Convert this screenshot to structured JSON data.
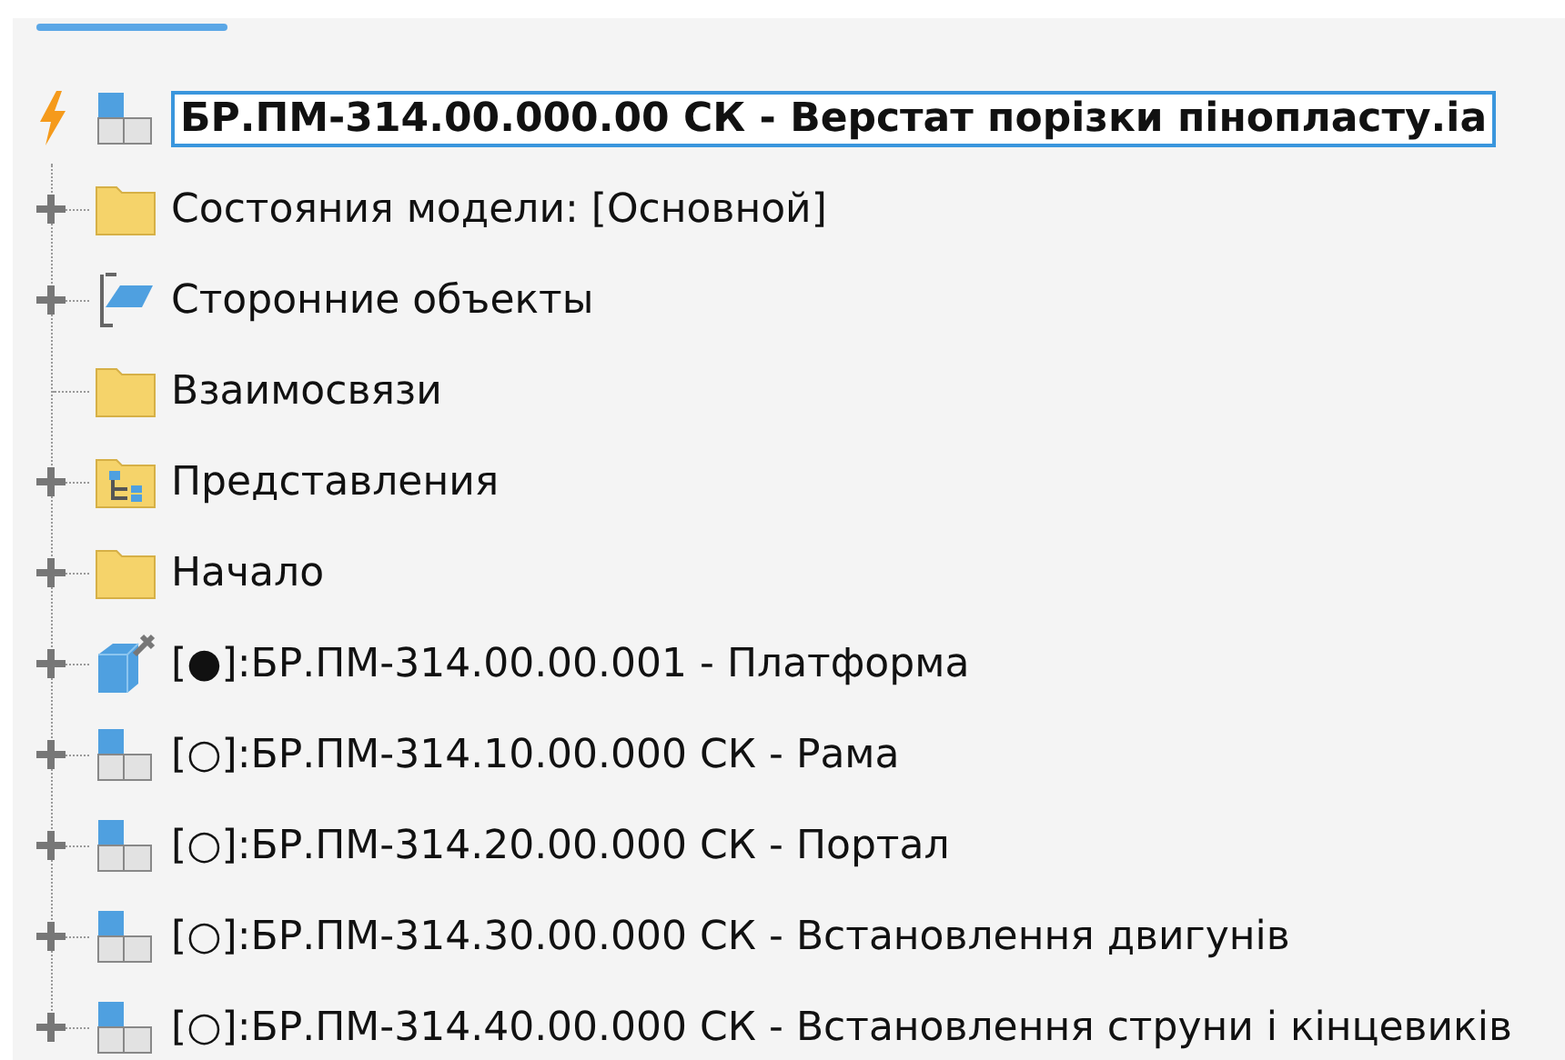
{
  "root": {
    "label": "БР.ПМ-314.00.000.00 СК - Верстат порізки пінопласту.ia",
    "editing": true
  },
  "items": [
    {
      "kind": "folder",
      "label": "Состояния модели: [Основной]",
      "expandable": true
    },
    {
      "kind": "external",
      "label": "Сторонние объекты",
      "expandable": true
    },
    {
      "kind": "folder",
      "label": "Взаимосвязи",
      "expandable": false
    },
    {
      "kind": "representations",
      "label": "Представления",
      "expandable": true
    },
    {
      "kind": "folder",
      "label": "Начало",
      "expandable": true
    },
    {
      "kind": "part",
      "label": "[●]:БР.ПМ-314.00.00.001 - Платформа",
      "expandable": true
    },
    {
      "kind": "assembly",
      "label": "[○]:БР.ПМ-314.10.00.000 СК - Рама",
      "expandable": true
    },
    {
      "kind": "assembly",
      "label": "[○]:БР.ПМ-314.20.00.000 СК - Портал",
      "expandable": true
    },
    {
      "kind": "assembly",
      "label": "[○]:БР.ПМ-314.30.00.000 СК - Встановлення двигунів",
      "expandable": true
    },
    {
      "kind": "assembly",
      "label": "[○]:БР.ПМ-314.40.00.000 СК - Встановлення струни і кінцевиків",
      "expandable": true
    }
  ]
}
